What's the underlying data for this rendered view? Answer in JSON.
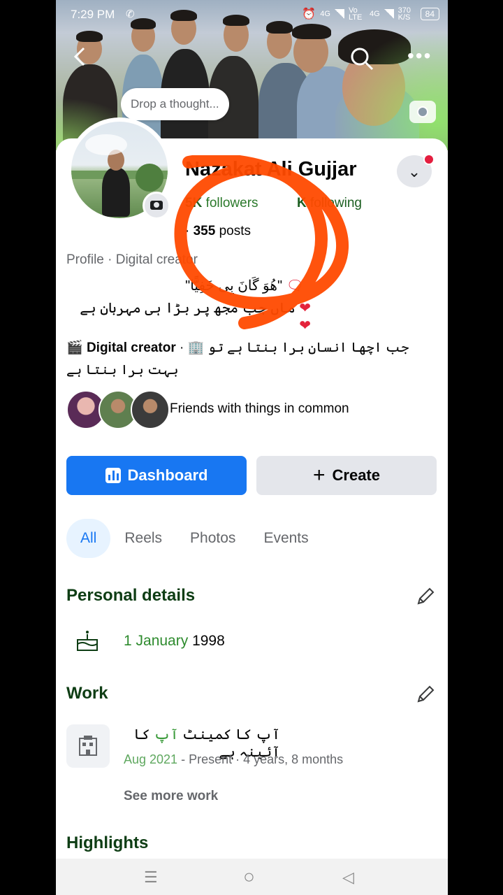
{
  "status_bar": {
    "time": "7:29 PM",
    "net1": "4G",
    "net2": "Vo LTE",
    "net3": "4G",
    "speed": "370 K/S",
    "battery": "84"
  },
  "cover": {
    "thought_placeholder": "Drop a thought...",
    "icons": [
      "back-icon",
      "search-icon",
      "more-icon",
      "camera-icon"
    ]
  },
  "profile": {
    "name": "Nazakat Ali Gujjar",
    "followers_count": "5K",
    "followers_label": "followers",
    "following_count": "K",
    "following_label": "following",
    "posts_count": "355",
    "posts_label": "posts",
    "category": "Profile · Digital creator",
    "bio_line1": "\"ھُوَ گَانَ بِی خَفِیًّا\"",
    "bio_line2": "ماں جب مجھ پر بڑا ہی مہربان ہے",
    "dc_label": "Digital creator",
    "dc_text": "جب اچھا انسان برا بنتا ہے تو بہت برا بنتا ہے"
  },
  "friends": {
    "text": "Friends with things in common"
  },
  "actions": {
    "dashboard": "Dashboard",
    "create": "Create"
  },
  "tabs": [
    "All",
    "Reels",
    "Photos",
    "Events"
  ],
  "personal_details": {
    "heading": "Personal details",
    "birthday_day_month": "1 January",
    "birthday_year": "1998"
  },
  "work": {
    "heading": "Work",
    "title_part1": "آپ کا کمینٹ",
    "title_part2": "آپ",
    "title_part3": "کا آئینہ ہے",
    "dates_start": "Aug 2021",
    "dates_rest": "- Present · 4 years, 8 months",
    "see_more": "See more work"
  },
  "highlights": {
    "heading": "Highlights"
  },
  "nav": {
    "menu": "☰",
    "home": "○",
    "back": "◁"
  },
  "colors": {
    "accent": "#1877f2",
    "green_text": "#2e8b2e",
    "annotation": "#ff4a00"
  }
}
